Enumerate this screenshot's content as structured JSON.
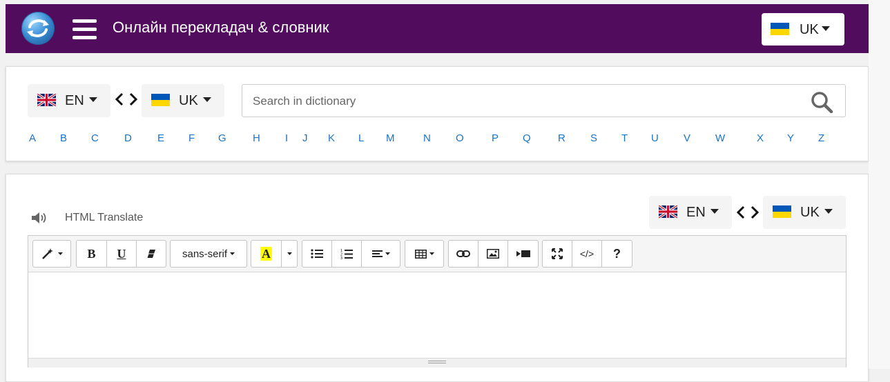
{
  "header": {
    "title": "Онлайн перекладач & словник",
    "lang_code": "UK"
  },
  "search_panel": {
    "source_lang": "EN",
    "target_lang": "UK",
    "search_placeholder": "Search in dictionary",
    "search_value": "",
    "alphabet": [
      "A",
      "B",
      "C",
      "D",
      "E",
      "F",
      "G",
      "H",
      "I",
      "J",
      "K",
      "L",
      "M",
      "N",
      "O",
      "P",
      "Q",
      "R",
      "S",
      "T",
      "U",
      "V",
      "W",
      "X",
      "Y",
      "Z"
    ]
  },
  "editor_panel": {
    "label": "HTML Translate",
    "source_lang": "EN",
    "target_lang": "UK",
    "toolbar": {
      "bold": "B",
      "underline": "U",
      "font_name": "sans-serif",
      "highlight_letter": "A",
      "code_view": "</>",
      "help": "?"
    },
    "content": ""
  },
  "colors": {
    "header_bg": "#520c5e",
    "link_blue": "#1a73c8",
    "highlight_yellow": "#ffff00"
  },
  "icons": {
    "header": [
      "app-logo-icon",
      "hamburger-menu-icon",
      "ukraine-flag-icon",
      "caret-down-icon"
    ],
    "search": [
      "uk-flag-icon",
      "ukraine-flag-icon",
      "swap-languages-icon",
      "search-icon"
    ],
    "editor": [
      "speaker-icon",
      "magic-wand-icon",
      "eraser-icon",
      "bullet-list-icon",
      "numbered-list-icon",
      "align-icon",
      "table-icon",
      "link-icon",
      "image-icon",
      "video-icon",
      "fullscreen-icon"
    ]
  }
}
